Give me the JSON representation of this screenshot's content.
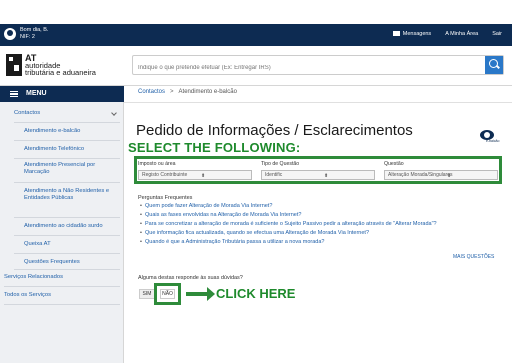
{
  "topbar": {
    "greeting": "Bom dia, B.",
    "nif": "NIF: 2",
    "nav": [
      "Mensagens",
      "A Minha Área",
      "Sair"
    ]
  },
  "header": {
    "logo_line1": "AT",
    "logo_line2": "autoridade",
    "logo_line3": "tributária e aduaneira",
    "search_placeholder": "Indique o que pretende efetuar (Ex: Entregar IRS)"
  },
  "menu": {
    "label": "MENU"
  },
  "sidebar": {
    "section": "Contactos",
    "items": [
      "Atendimento e-balcão",
      "Atendimento Telefónico",
      "Atendimento Presencial por Marcação",
      "Atendimento a Não Residentes e Entidades Públicas",
      "Atendimento ao cidadão surdo",
      "Queixa AT",
      "Questões Frequentes"
    ],
    "bottom": [
      "Serviços Relacionados",
      "Todos os Serviços"
    ]
  },
  "breadcrumb": {
    "link": "Contactos",
    "sep": ">",
    "current": "Atendimento e-balcão"
  },
  "page": {
    "title": "Pedido de Informações / Esclarecimentos",
    "help_label": "e-balcão"
  },
  "annotations": {
    "select_following": "SELECT THE FOLLOWING:",
    "click_here": "CLICK HERE"
  },
  "form": {
    "fields": [
      {
        "label": "Imposto ou área",
        "value": "Registo Contribuinte"
      },
      {
        "label": "Tipo de Questão",
        "value": "Identific"
      },
      {
        "label": "Questão",
        "value": "Alteração Morada/Singulares"
      }
    ]
  },
  "faq": {
    "title": "Perguntas Frequentes",
    "items": [
      "Quem pode fazer Alteração de Morada Via Internet?",
      "Quais as fases envolvidas na Alteração de Morada Via Internet?",
      "Para se concretizar a alteração de morada é suficiente o Sujeito Passivo pedir a alteração através de \"Alterar Morada\"?",
      "Que informação fica actualizada, quando se efectua uma Alteração de Morada Via Internet?",
      "Quando é que a Administração Tributária passa a utilizar a nova morada?"
    ],
    "more": "MAIS QUESTÕES"
  },
  "answer": {
    "question": "Alguma destas responde às suas dúvidas?",
    "yes": "SIM",
    "no": "NÃO"
  },
  "colors": {
    "navy": "#0d2b52",
    "link": "#1f5fa8",
    "annotation_green": "#2e8b3a"
  }
}
